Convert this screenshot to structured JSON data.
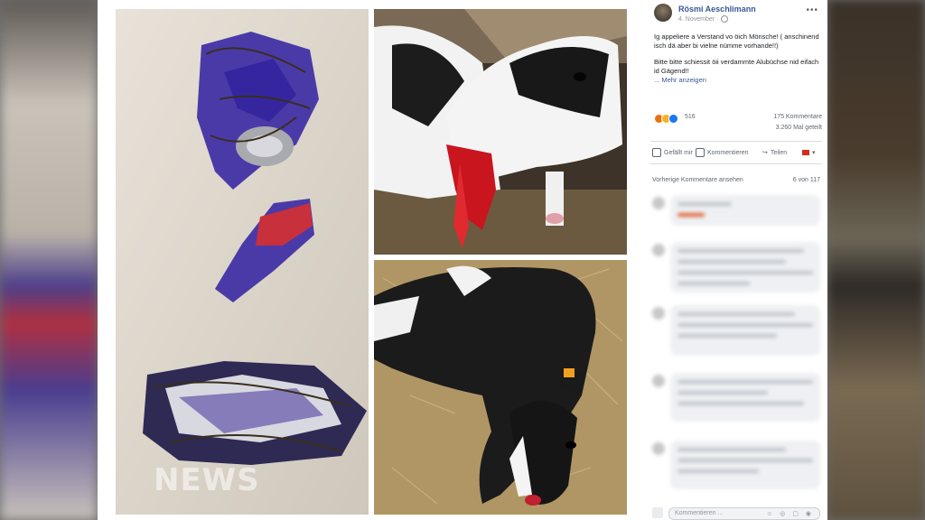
{
  "overlay": {
    "logo": "NEWS"
  },
  "post": {
    "author_name": "Rösmi Aeschlimann",
    "date": "4. November ·",
    "text_paragraph_1": "Ig appeliere a Verstand vo öich Mönsche! ( anschinend isch dä aber bi vielne nümme vorhande!!)",
    "text_paragraph_2": "Bitte bitte schiessit öii verdammte Alubüchse nid eifach id Gägend!!",
    "see_more": "... Mehr anzeigen",
    "reaction_icons": [
      "angry-icon",
      "sad-icon",
      "like-icon"
    ],
    "reaction_count": "516",
    "comment_count": "175 Kommentare",
    "share_count": "3.260 Mal geteilt",
    "more_icon": "more-dots-icon"
  },
  "actions": {
    "like_label": "Gefällt mir",
    "comment_label": "Kommentieren",
    "share_label": "Teilen"
  },
  "comments": {
    "previous_label": "Vorherige Kommentare ansehen",
    "previous_count": "6 von 117",
    "input_placeholder": "Kommentieren ..."
  },
  "colors": {
    "link": "#385898",
    "text": "#1c1e21",
    "muted": "#606770"
  }
}
